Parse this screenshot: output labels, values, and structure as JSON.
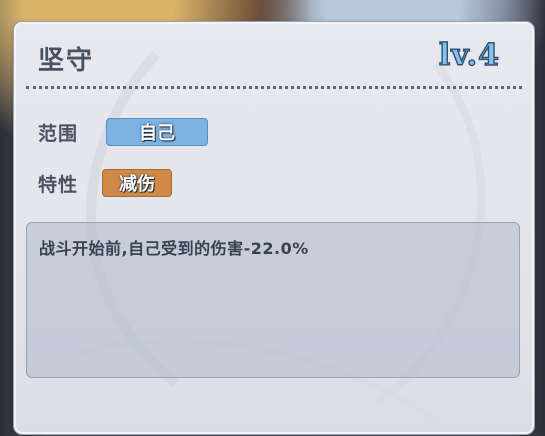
{
  "skill": {
    "name": "坚守",
    "level": "lv.4"
  },
  "range": {
    "label": "范围",
    "value": "自己"
  },
  "trait": {
    "label": "特性",
    "value": "减伤"
  },
  "description": "战斗开始前,自己受到的伤害-22.0%",
  "colors": {
    "range_tag": "#7bb3e2",
    "trait_tag": "#cf8a48",
    "level_text": "#7fc4ec",
    "card_bg": "#e4e7ed"
  }
}
